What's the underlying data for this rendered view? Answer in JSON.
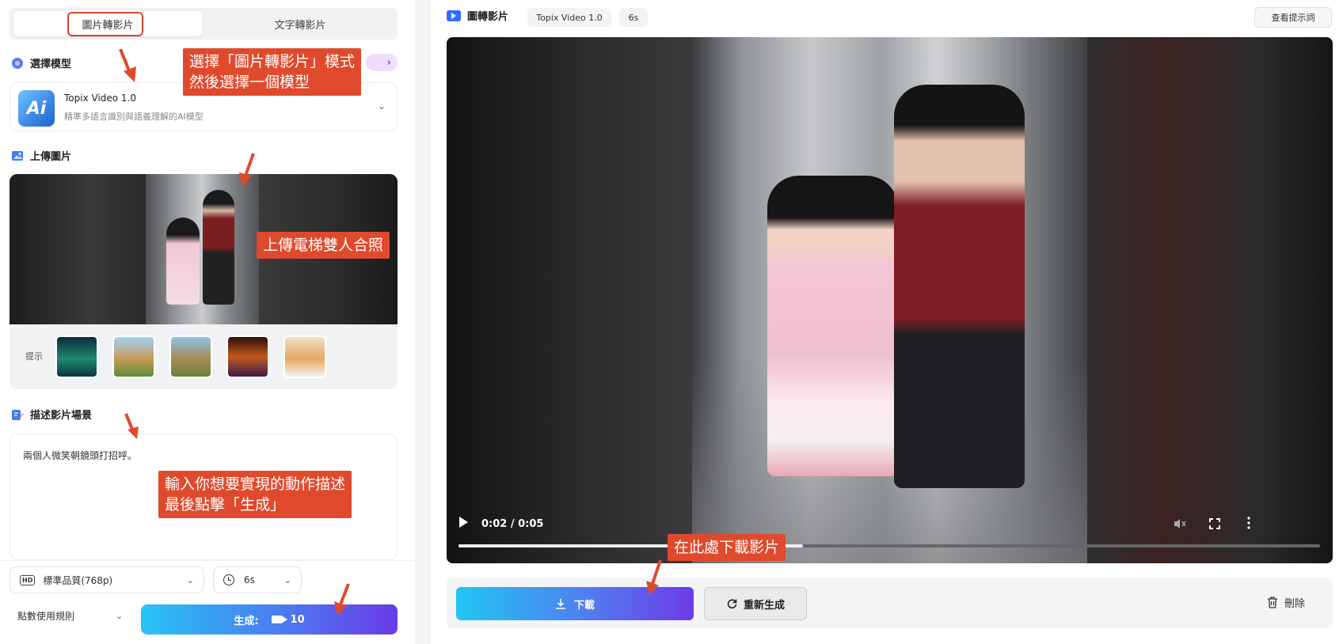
{
  "left": {
    "tabs": {
      "image_to_video": "圖片轉影片",
      "text_to_video": "文字轉影片"
    },
    "model_section": {
      "title": "選擇模型",
      "model_name": "Topix Video 1.0",
      "model_desc": "精準多語言識別與語義理解的AI模型",
      "logo_text": "Ai"
    },
    "upload_section": {
      "title": "上傳圖片",
      "hint_label": "提示"
    },
    "describe_section": {
      "title": "描述影片場景",
      "prompt_text": "兩個人微笑朝鏡頭打招呼。"
    },
    "quality_select": "標準品質(768p)",
    "hd_badge": "HD",
    "duration_select": "6s",
    "rules_label": "點數使用規則",
    "generate_label": "生成:",
    "generate_cost": "10"
  },
  "right": {
    "title": "圖轉影片",
    "chip_model": "Topix Video 1.0",
    "chip_duration": "6s",
    "view_prompt": "查看提示詞",
    "video": {
      "time": "0:02 / 0:05",
      "progress_fraction": 0.4
    },
    "download_label": "下載",
    "regenerate_label": "重新生成",
    "delete_label": "刪除"
  },
  "annotations": {
    "note1_line1": "選擇「圖片轉影片」模式",
    "note1_line2": "然後選擇一個模型",
    "note2": "上傳電梯雙人合照",
    "note3_line1": "輸入你想要實現的動作描述",
    "note3_line2": "最後點擊「生成」",
    "note4": "在此處下載影片"
  },
  "colors": {
    "annotation": "#e04a2c",
    "accent_start": "#22c6f3",
    "accent_end": "#6e3ae6"
  }
}
